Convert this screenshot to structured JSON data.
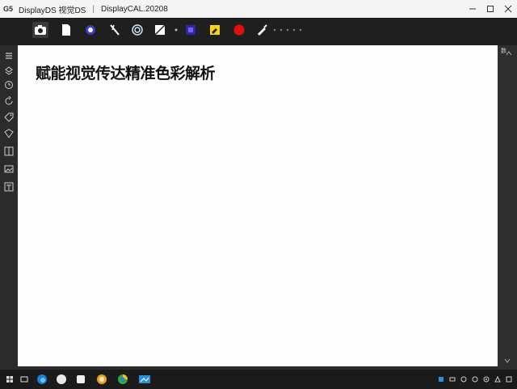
{
  "window": {
    "logo": "G5",
    "title": "DisplayDS 视觉DS",
    "separator": "|",
    "subtitle": "DisplayCAL.20208"
  },
  "toolbar": {
    "tools": [
      {
        "icon": "camera-icon",
        "label": ""
      },
      {
        "icon": "document-icon",
        "label": ""
      },
      {
        "icon": "color-wheel-icon",
        "label": ""
      },
      {
        "icon": "brush-icon",
        "label": ""
      },
      {
        "icon": "target-icon",
        "label": ""
      },
      {
        "icon": "crop-icon",
        "label": ""
      },
      {
        "icon": "dot-icon",
        "label": ""
      },
      {
        "icon": "gradient-icon",
        "label": ""
      },
      {
        "icon": "yellow-note-icon",
        "label": ""
      },
      {
        "icon": "red-record-icon",
        "label": ""
      },
      {
        "icon": "pen-icon",
        "label": ""
      }
    ],
    "extra_icon": "settings-icon"
  },
  "sidebar": {
    "items": [
      "collapse-icon",
      "layers-icon",
      "history-icon",
      "refresh-icon",
      "tag-icon",
      "bookmark-icon",
      "grid-icon",
      "image-icon",
      "text-icon"
    ]
  },
  "canvas": {
    "title": "赋能视觉传达精准色彩解析"
  },
  "rightpanel": {
    "label": "数"
  },
  "taskbar": {
    "apps": [
      "start-icon",
      "search-icon",
      "edge-icon",
      "circle-icon",
      "files-icon",
      "photo-icon",
      "chrome-icon",
      "display-app-icon"
    ],
    "tray": [
      "network-icon",
      "chat-icon",
      "volume-icon",
      "battery-icon",
      "settings-tray-icon",
      "clock-icon",
      "notification-icon"
    ]
  }
}
